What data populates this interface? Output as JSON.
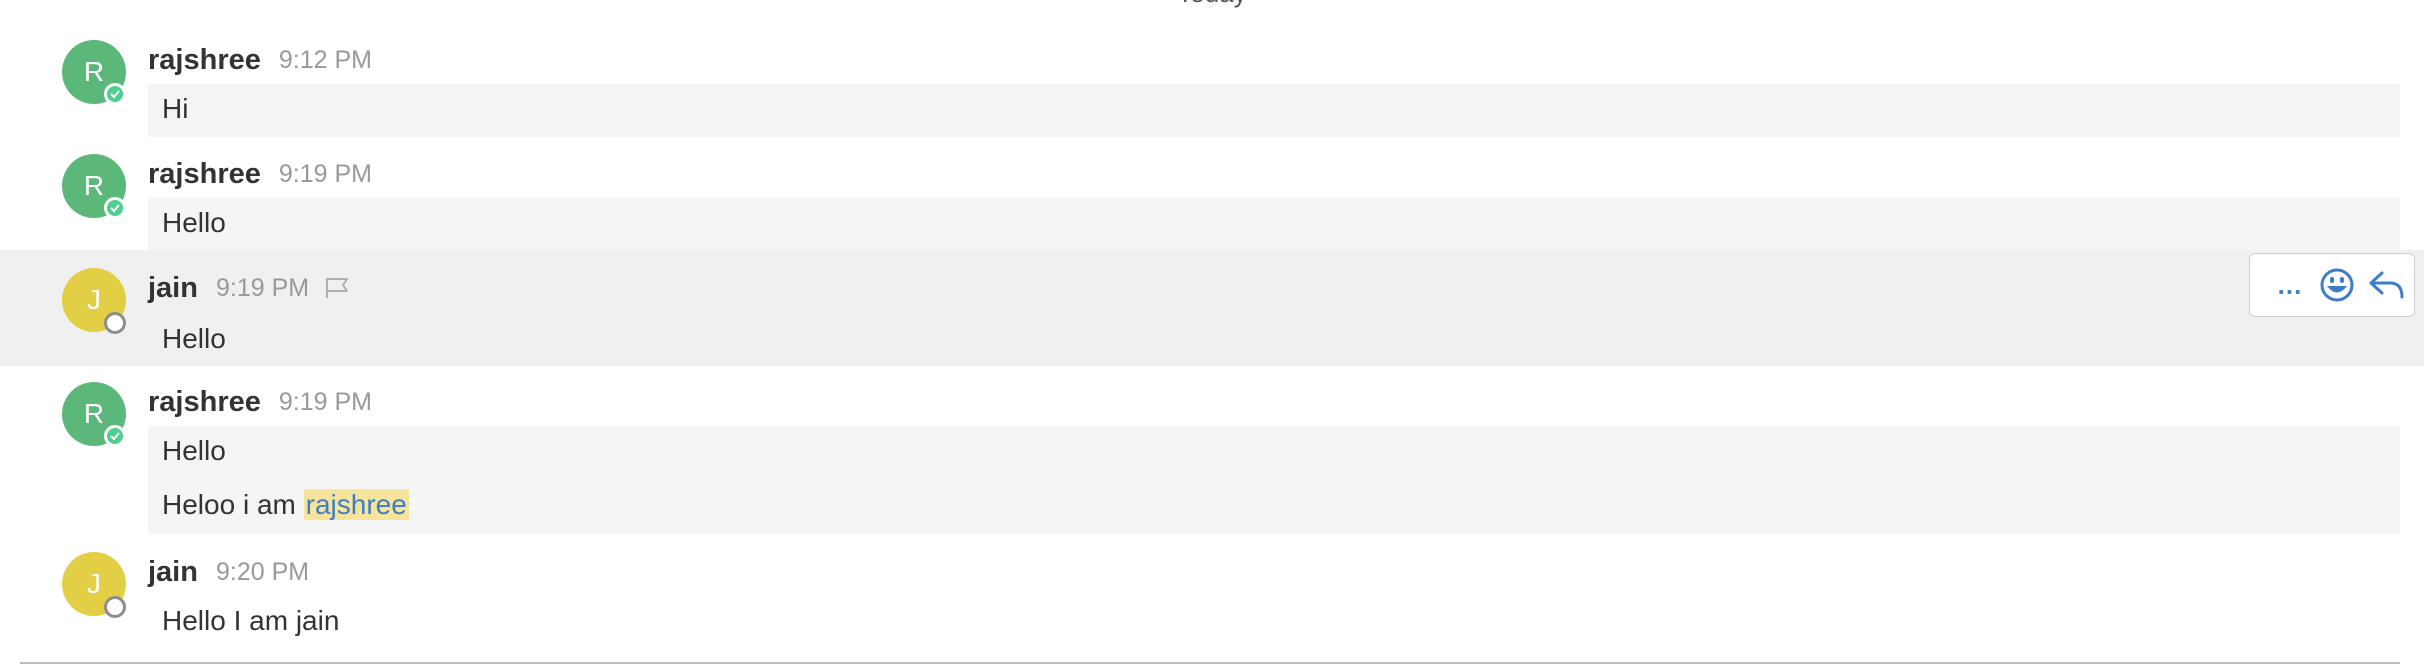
{
  "date_separator": "Today",
  "messages": [
    {
      "user": "rajshree",
      "initial": "R",
      "time": "9:12 PM",
      "lines": [
        "Hi"
      ]
    },
    {
      "user": "rajshree",
      "initial": "R",
      "time": "9:19 PM",
      "lines": [
        "Hello"
      ]
    },
    {
      "user": "jain",
      "initial": "J",
      "time": "9:19 PM",
      "lines": [
        "Hello"
      ]
    },
    {
      "user": "rajshree",
      "initial": "R",
      "time": "9:19 PM",
      "lines": [
        "Hello",
        "Heloo i am "
      ],
      "mention": "rajshree"
    },
    {
      "user": "jain",
      "initial": "J",
      "time": "9:20 PM",
      "lines": [
        "Hello I am jain"
      ]
    }
  ],
  "hover_actions": {
    "more_label": "...",
    "icons": [
      "more-icon",
      "emoji-icon",
      "reply-icon"
    ]
  },
  "colors": {
    "rajshree_avatar": "#5cb87a",
    "jain_avatar": "#e2cf46",
    "online_status": "#4ccf8f",
    "accent": "#3d7dca",
    "bubble_bg": "#f5f5f5",
    "hover_bg": "#f0f0f0"
  }
}
